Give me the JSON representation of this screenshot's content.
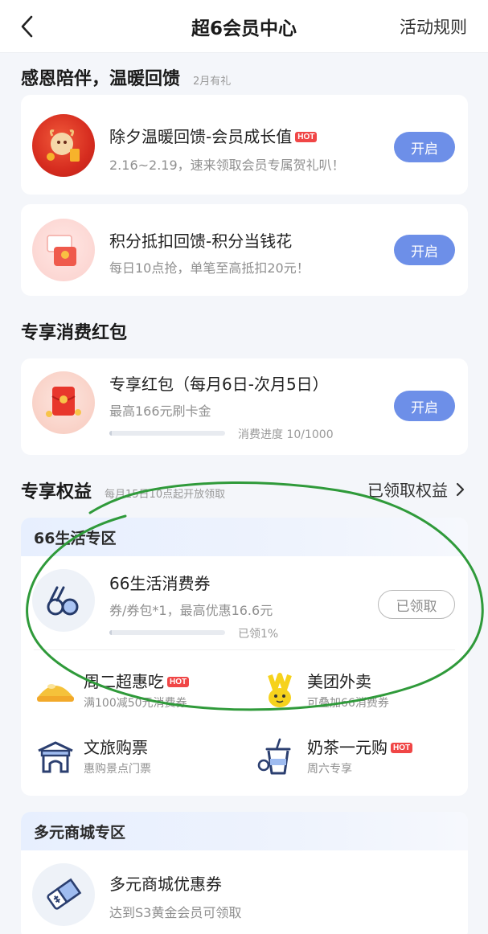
{
  "header": {
    "title": "超6会员中心",
    "rules": "活动规则"
  },
  "section1": {
    "title": "感恩陪伴，温暖回馈",
    "sub": "2月有礼",
    "items": [
      {
        "title": "除夕温暖回馈-会员成长值",
        "badge": "HOT",
        "desc": "2.16~2.19，速来领取会员专属贺礼叭！",
        "button": "开启"
      },
      {
        "title": "积分抵扣回馈-积分当钱花",
        "desc": "每日10点抢，单笔至高抵扣20元！",
        "button": "开启"
      }
    ]
  },
  "section2": {
    "title": "专享消费红包",
    "item": {
      "title": "专享红包（每月6日-次月5日）",
      "desc": "最高166元刷卡金",
      "progress_text": "消费进度 10/1000",
      "progress": 0.01,
      "button": "开启"
    }
  },
  "section3": {
    "title": "专享权益",
    "sub": "每月15日10点起开放领取",
    "link": "已领取权益",
    "zone": "66生活专区",
    "coupon": {
      "title": "66生活消费券",
      "desc": "券/券包*1，最高优惠16.6元",
      "progress_text": "已领1%",
      "progress": 0.01,
      "button": "已领取"
    },
    "grid": [
      {
        "title": "周二超惠吃",
        "badge": "HOT",
        "sub": "满100减50元消费券",
        "icon": "food-icon"
      },
      {
        "title": "美团外卖",
        "sub": "可叠加66消费券",
        "icon": "meituan-icon"
      },
      {
        "title": "文旅购票",
        "sub": "惠购景点门票",
        "icon": "temple-icon"
      },
      {
        "title": "奶茶一元购",
        "badge": "HOT",
        "sub": "周六专享",
        "icon": "milk-tea-icon"
      }
    ]
  },
  "section4": {
    "zone": "多元商城专区",
    "item": {
      "title": "多元商城优惠券",
      "desc": "达到S3黄金会员可领取"
    }
  },
  "colors": {
    "primary_button": "#6d8fe8",
    "hot": "#f04646",
    "annotation_circle": "#2f9a3a"
  }
}
